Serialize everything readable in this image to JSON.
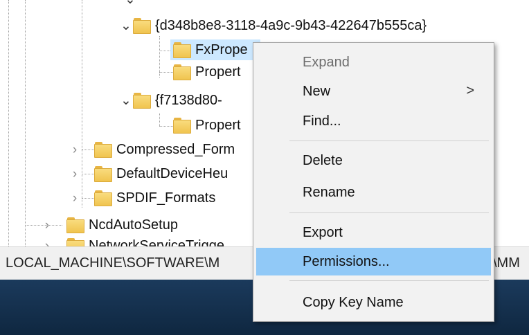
{
  "tree": {
    "nodes": [
      {
        "label": "{d348b8e8-3118-4a9c-9b43-422647b555ca}",
        "expander": "down"
      },
      {
        "label": "FxPrope",
        "expander": "none",
        "selected": true
      },
      {
        "label": "Propert",
        "expander": "none"
      },
      {
        "label": "{f7138d80-",
        "expander": "down"
      },
      {
        "label": "Propert",
        "expander": "none"
      },
      {
        "label": "Compressed_Form",
        "expander": "right"
      },
      {
        "label": "DefaultDeviceHeu",
        "expander": "right"
      },
      {
        "label": "SPDIF_Formats",
        "expander": "right"
      },
      {
        "label": "NcdAutoSetup",
        "expander": "right"
      },
      {
        "label": "NetworkServiceTrigge",
        "expander": "right"
      }
    ]
  },
  "pathbar": {
    "path": "LOCAL_MACHINE\\SOFTWARE\\M",
    "path_tail": "\\MM"
  },
  "context_menu": {
    "items": [
      {
        "label": "Expand",
        "disabled": true
      },
      {
        "label": "New",
        "has_submenu": true,
        "submenu_arrow": ">"
      },
      {
        "label": "Find..."
      },
      {
        "label": "Delete"
      },
      {
        "label": "Rename"
      },
      {
        "label": "Export"
      },
      {
        "label": "Permissions...",
        "highlighted": true
      },
      {
        "label": "Copy Key Name"
      }
    ]
  },
  "colors": {
    "selection": "#cce8ff",
    "menu_highlight": "#91c9f7",
    "menu_bg": "#f2f2f2",
    "folder": "#f0c44f",
    "taskbar": "#1b3a5c"
  },
  "icons": {
    "folder": "folder-icon",
    "expanded": "chevron-down-icon",
    "collapsed": "chevron-right-icon",
    "submenu": "chevron-right-icon"
  }
}
